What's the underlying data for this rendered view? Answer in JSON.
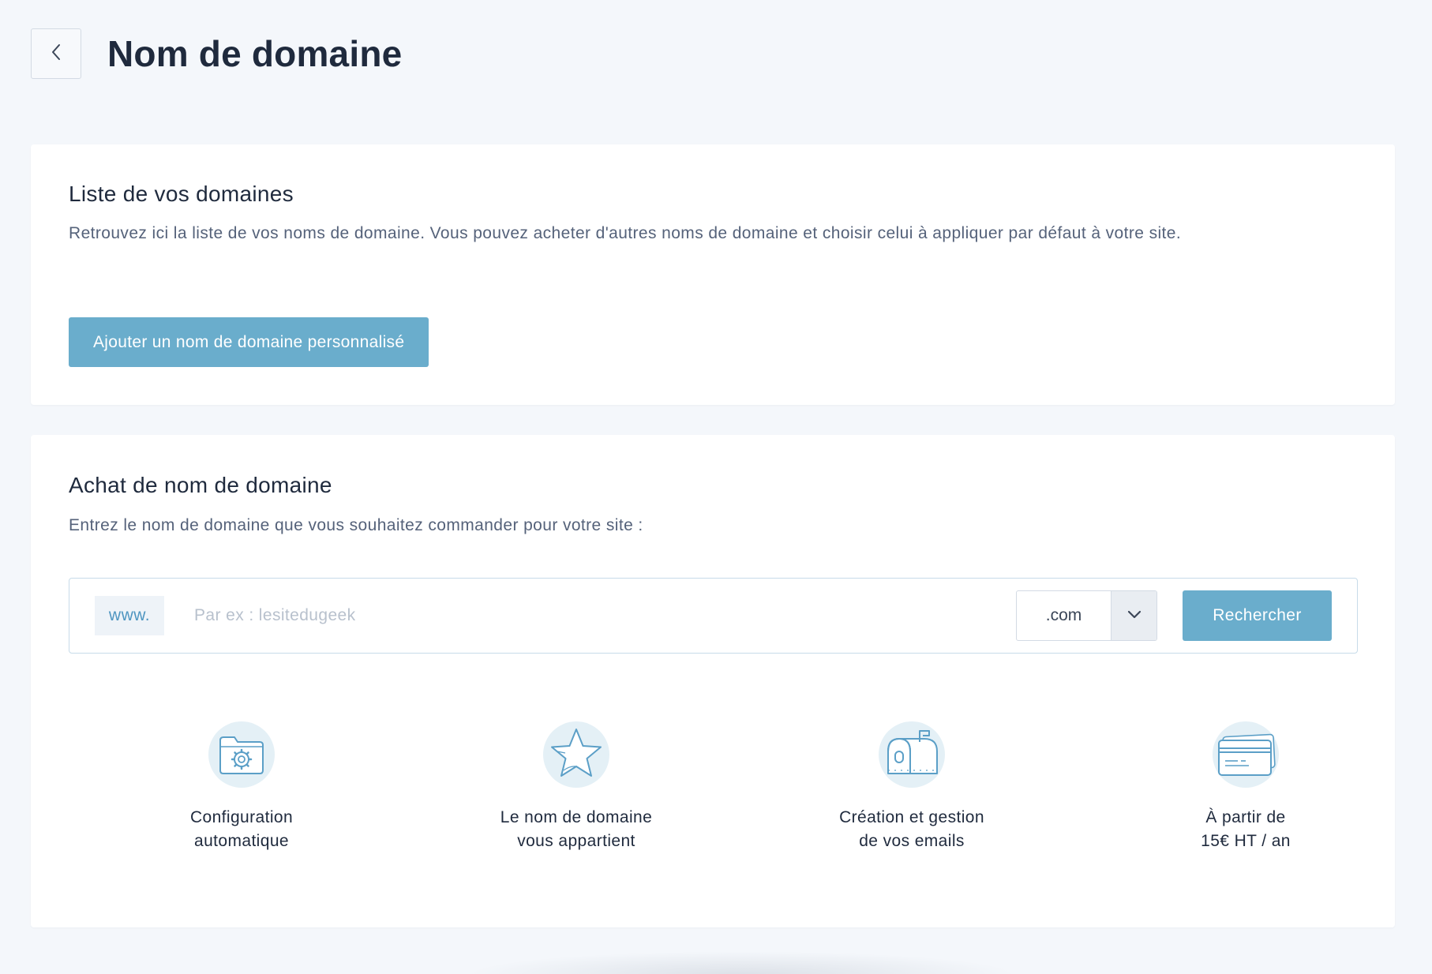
{
  "header": {
    "title": "Nom de domaine"
  },
  "domains_list": {
    "title": "Liste de vos domaines",
    "description": "Retrouvez ici la liste de vos noms de domaine. Vous pouvez acheter d'autres noms de domaine et choisir celui à appliquer par défaut à votre site.",
    "add_button_label": "Ajouter un nom de domaine personnalisé"
  },
  "purchase": {
    "title": "Achat de nom de domaine",
    "description": "Entrez le nom de domaine que vous souhaitez commander pour votre site :",
    "prefix": "www.",
    "input_value": "",
    "input_placeholder": "Par ex : lesitedugeek",
    "tld_selected": ".com",
    "search_button_label": "Rechercher"
  },
  "features": [
    {
      "icon": "folder-gear-icon",
      "line1": "Configuration",
      "line2": "automatique"
    },
    {
      "icon": "star-icon",
      "line1": "Le nom de domaine",
      "line2": "vous appartient"
    },
    {
      "icon": "mailbox-icon",
      "line1": "Création et gestion",
      "line2": "de vos emails"
    },
    {
      "icon": "credit-card-icon",
      "line1": "À partir de",
      "line2": "15€ HT / an"
    }
  ],
  "colors": {
    "background": "#f4f7fb",
    "accent": "#6aadcc",
    "icon_circle": "#e4f0f6",
    "icon_stroke": "#5b9fc7",
    "title_text": "#1f2a3d",
    "muted_text": "#55627a"
  }
}
